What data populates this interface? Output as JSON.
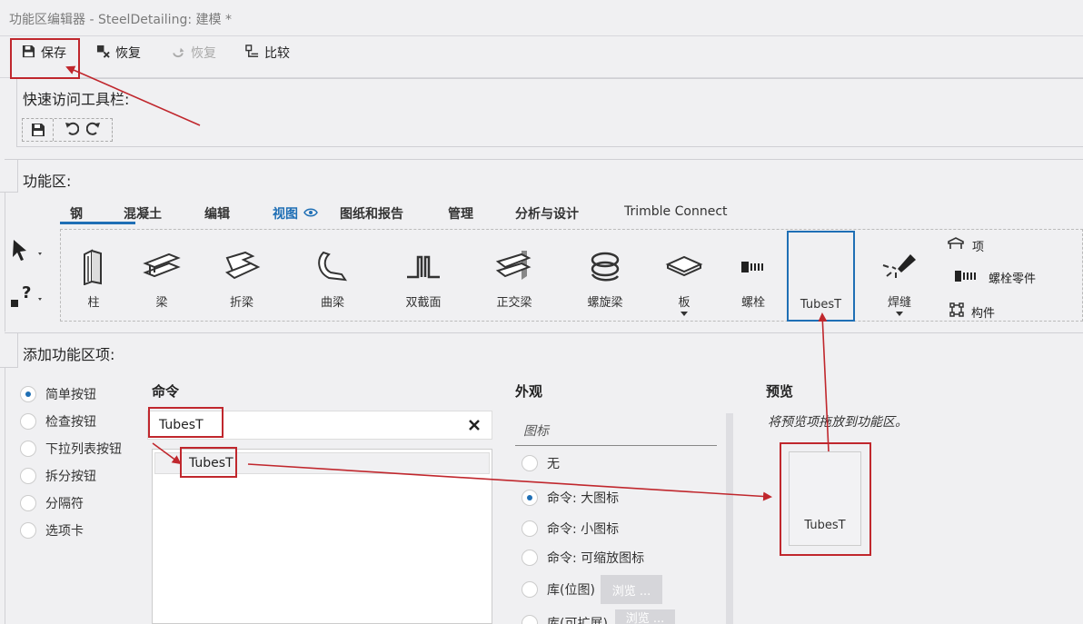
{
  "window": {
    "title": "功能区编辑器 - SteelDetailing: 建模 *"
  },
  "toolbar": {
    "save": "保存",
    "restore": "恢复",
    "redo": "恢复",
    "compare": "比较"
  },
  "quick_access": {
    "title": "快速访问工具栏:"
  },
  "ribbon": {
    "title": "功能区:",
    "tabs": [
      "钢",
      "混凝土",
      "编辑",
      "视图",
      "图纸和报告",
      "管理",
      "分析与设计",
      "Trimble Connect"
    ],
    "active_tab": "钢",
    "items": [
      "柱",
      "梁",
      "折梁",
      "曲梁",
      "双截面",
      "正交梁",
      "螺旋梁",
      "板",
      "螺栓",
      "TubesT",
      "焊缝"
    ],
    "small_items": [
      "项",
      "螺栓零件",
      "构件"
    ]
  },
  "add_item": {
    "title": "添加功能区项:",
    "types": [
      "简单按钮",
      "检查按钮",
      "下拉列表按钮",
      "拆分按钮",
      "分隔符",
      "选项卡"
    ],
    "selected_type": "简单按钮"
  },
  "command": {
    "header": "命令",
    "search_value": "TubesT",
    "results": [
      "TubesT"
    ]
  },
  "appearance": {
    "header": "外观",
    "icon_group": "图标",
    "options": [
      "无",
      "命令: 大图标",
      "命令: 小图标",
      "命令: 可缩放图标",
      "库(位图)",
      "库(可扩展)"
    ],
    "selected": "命令: 大图标",
    "browse": "浏览 ..."
  },
  "preview": {
    "header": "预览",
    "hint": "将预览项拖放到功能区。",
    "item_label": "TubesT"
  },
  "colors": {
    "accent": "#1f6fb5",
    "annotation": "#c0272d"
  }
}
